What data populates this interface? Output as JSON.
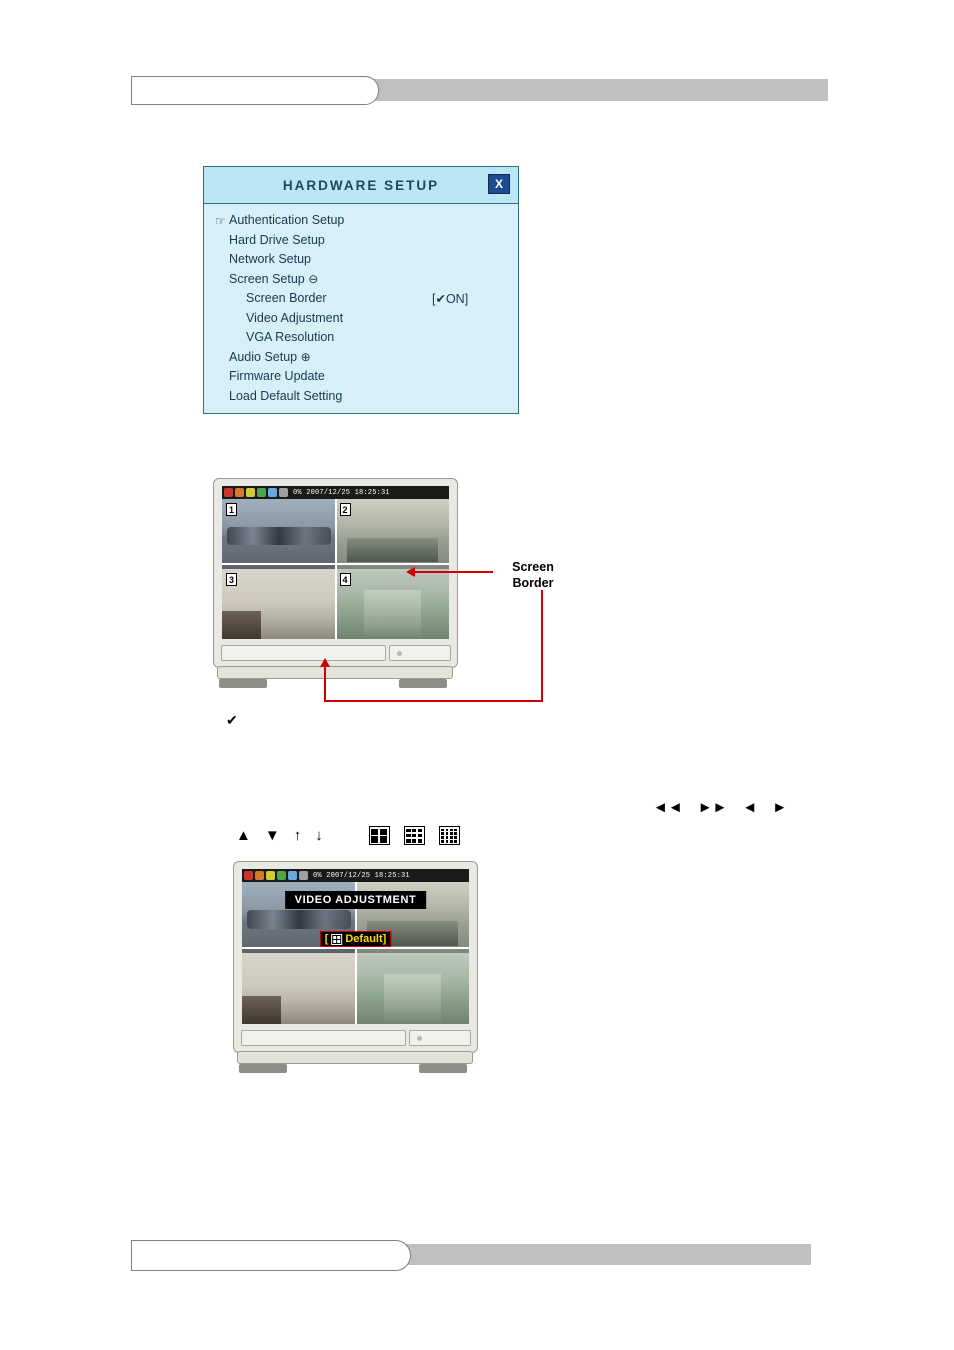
{
  "page": {
    "header_bar": "",
    "footer_bar": ""
  },
  "osd_dialog": {
    "title": "HARDWARE SETUP",
    "close_label": "X",
    "cursor_glyph": "☞",
    "items": [
      {
        "label": "Authentication Setup",
        "indent": 0,
        "selected": true,
        "sign": "",
        "value": ""
      },
      {
        "label": "Hard Drive Setup",
        "indent": 0,
        "selected": false,
        "sign": "",
        "value": ""
      },
      {
        "label": "Network Setup",
        "indent": 0,
        "selected": false,
        "sign": "",
        "value": ""
      },
      {
        "label": "Screen Setup",
        "indent": 0,
        "selected": false,
        "sign": "⊖",
        "value": ""
      },
      {
        "label": "Screen Border",
        "indent": 1,
        "selected": false,
        "sign": "",
        "value": "[✔ON]"
      },
      {
        "label": "Video Adjustment",
        "indent": 1,
        "selected": false,
        "sign": "",
        "value": ""
      },
      {
        "label": "VGA Resolution",
        "indent": 1,
        "selected": false,
        "sign": "",
        "value": ""
      },
      {
        "label": "Audio Setup",
        "indent": 0,
        "selected": false,
        "sign": "⊕",
        "value": ""
      },
      {
        "label": "Firmware Update",
        "indent": 0,
        "selected": false,
        "sign": "",
        "value": ""
      },
      {
        "label": "Load Default Setting",
        "indent": 0,
        "selected": false,
        "sign": "",
        "value": ""
      }
    ]
  },
  "device_top": {
    "status_text": "0%  2007/12/25  18:25:31",
    "status_icons": [
      "record-icon",
      "alarm-icon",
      "motion-icon",
      "network-icon",
      "hdd-icon",
      "usb-icon"
    ],
    "channels": [
      {
        "number": "1",
        "scene": "parking-lot"
      },
      {
        "number": "2",
        "scene": "garage"
      },
      {
        "number": "3",
        "scene": "room"
      },
      {
        "number": "4",
        "scene": "warehouse"
      }
    ]
  },
  "callout": {
    "line1": "Screen",
    "line2": "Border"
  },
  "tick": {
    "glyph": "✔"
  },
  "keys": {
    "nav_glyphs": [
      "rewind-icon",
      "fast-forward-icon",
      "prev-icon",
      "next-icon"
    ],
    "arrow_glyphs": [
      "arrow-up-filled",
      "arrow-down-filled",
      "arrow-up-thin",
      "arrow-down-thin"
    ],
    "grid_buttons": [
      "quad-split-icon",
      "nine-split-icon",
      "sixteen-split-icon"
    ]
  },
  "device_bottom": {
    "status_text": "0%  2007/12/25  18:25:31",
    "overlay_title": "VIDEO ADJUSTMENT",
    "overlay_value_open": "[",
    "overlay_value_text": "Default]",
    "overlay_icon": "quad-split-icon",
    "channels": [
      {
        "number": "",
        "scene": "parking-lot"
      },
      {
        "number": "",
        "scene": "garage"
      },
      {
        "number": "",
        "scene": "room"
      },
      {
        "number": "",
        "scene": "warehouse"
      }
    ]
  },
  "colors": {
    "osd_background": "#d7f0f7",
    "osd_title_background": "#b9e6f2",
    "osd_border": "#2f6f86",
    "close_button": "#1b4c8f",
    "callout_red": "#d00000",
    "highlight_yellow": "#ffd900",
    "bar_gray": "#bfbfbf"
  }
}
